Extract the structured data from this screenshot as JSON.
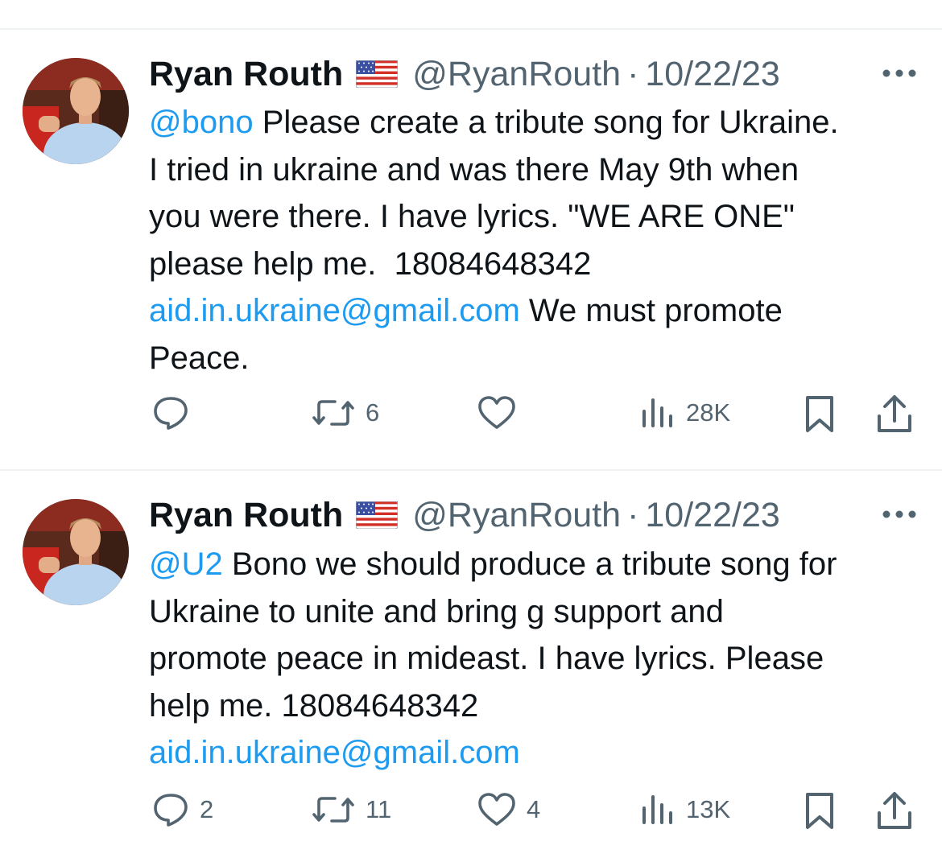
{
  "tweets": [
    {
      "display_name": "Ryan Routh",
      "flag_icon": "us-flag-icon",
      "handle": "@RyanRouth",
      "separator": "·",
      "date": "10/22/23",
      "body": [
        [
          {
            "t": "@bono",
            "link": true
          },
          {
            "t": " Please create a tribute song for Ukraine.",
            "link": false
          }
        ],
        [
          {
            "t": "I tried in ukraine and was there May 9th when",
            "link": false
          }
        ],
        [
          {
            "t": "you were there. I have lyrics. \"WE ARE ONE\"",
            "link": false
          }
        ],
        [
          {
            "t": "please help me.  18084648342",
            "link": false
          }
        ],
        [
          {
            "t": "aid.in.ukraine@gmail.com",
            "link": true
          },
          {
            "t": " We must promote",
            "link": false
          }
        ],
        [
          {
            "t": "Peace.",
            "link": false
          }
        ]
      ],
      "actions": {
        "reply": "",
        "retweet": "6",
        "like": "",
        "views": "28K"
      }
    },
    {
      "display_name": "Ryan Routh",
      "flag_icon": "us-flag-icon",
      "handle": "@RyanRouth",
      "separator": "·",
      "date": "10/22/23",
      "body": [
        [
          {
            "t": "@U2",
            "link": true
          },
          {
            "t": " Bono we should produce a tribute song for",
            "link": false
          }
        ],
        [
          {
            "t": "Ukraine to unite and bring g support and",
            "link": false
          }
        ],
        [
          {
            "t": "promote peace in mideast. I have lyrics. Please",
            "link": false
          }
        ],
        [
          {
            "t": "help me. 18084648342",
            "link": false
          }
        ],
        [
          {
            "t": "aid.in.ukraine@gmail.com",
            "link": true
          }
        ]
      ],
      "actions": {
        "reply": "2",
        "retweet": "11",
        "like": "4",
        "views": "13K"
      }
    }
  ],
  "colors": {
    "link": "#1d9bf0",
    "secondary_text": "#536471",
    "primary_text": "#0f1419",
    "divider": "#eff3f4"
  },
  "icons": [
    "more-options-icon",
    "reply-icon",
    "retweet-icon",
    "like-icon",
    "views-icon",
    "bookmark-icon",
    "share-icon"
  ]
}
